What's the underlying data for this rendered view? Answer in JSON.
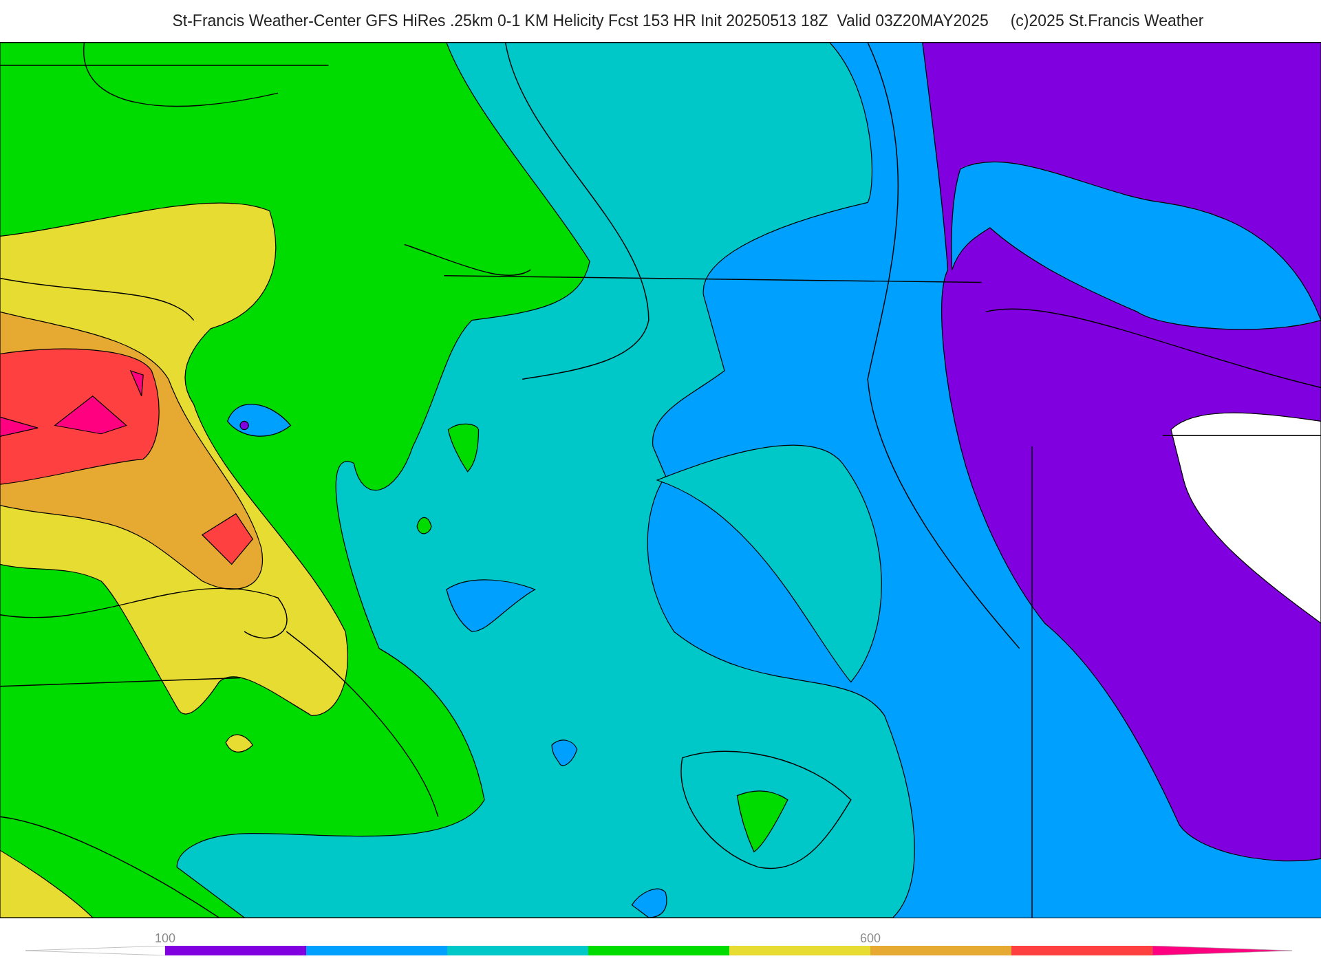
{
  "title": "St-Francis Weather-Center GFS HiRes .25km 0-1 KM Helicity Fcst 153 HR Init 20250513 18Z  Valid 03Z20MAY2025     (c)2025 St.Francis Weather",
  "colorbar": {
    "high_end": {
      "color": "#ff0080"
    },
    "segments": [
      {
        "color": "#8000e0",
        "label": "100"
      },
      {
        "color": "#00a0ff"
      },
      {
        "color": "#00c8c8"
      },
      {
        "color": "#00dc00"
      },
      {
        "color": "#e6dc32"
      },
      {
        "color": "#e6aa32",
        "label": "600"
      },
      {
        "color": "#ff4040"
      }
    ]
  }
}
